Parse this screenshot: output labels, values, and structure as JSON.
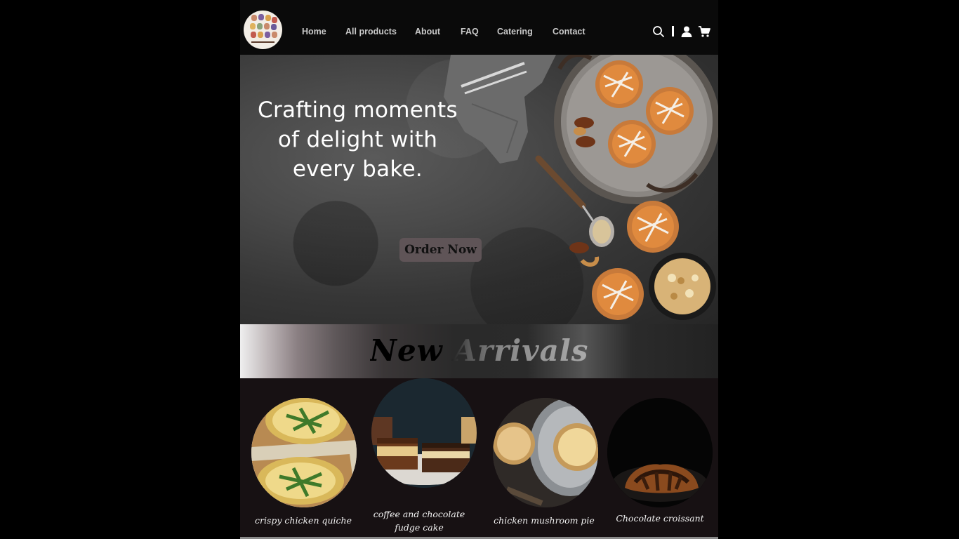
{
  "nav": {
    "links": [
      "Home",
      "All products",
      "About",
      "FAQ",
      "Catering",
      "Contact"
    ],
    "icons": [
      "search-icon",
      "user-icon",
      "cart-icon"
    ]
  },
  "logo": {
    "letters": [
      "B",
      "A",
      "K",
      "E",
      "B",
      "L",
      "I",
      "S",
      "S",
      "C",
      "A",
      "F",
      "E"
    ]
  },
  "hero": {
    "heading": "Crafting moments of delight with every bake.",
    "cta_label": "Order Now"
  },
  "arrivals": {
    "title": "New Arrivals"
  },
  "products": [
    {
      "name": "crispy chicken quiche"
    },
    {
      "name": "coffee and chocolate fudge cake"
    },
    {
      "name": "chicken mushroom pie"
    },
    {
      "name": "Chocolate croissant"
    }
  ],
  "colors": {
    "page_background": "#000000",
    "nav_background": "#0a0a0a",
    "nav_text": "#c9c9c9",
    "cta_background": "#5f5457",
    "products_background": "#171113"
  }
}
